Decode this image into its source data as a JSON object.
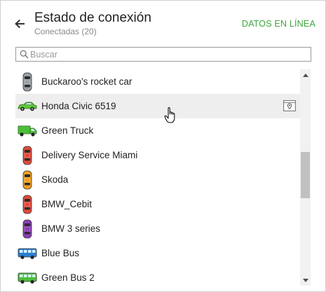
{
  "header": {
    "title": "Estado de conexión",
    "subtitle": "Conectadas (20)",
    "back_icon": "arrow-left-icon",
    "data_link": "DATOS EN LÍNEA"
  },
  "search": {
    "placeholder": "Buscar",
    "value": "",
    "icon": "search-icon"
  },
  "colors": {
    "accent": "#3aa63a",
    "hover_row": "#eeeeee",
    "scroll_thumb": "#c1c1c1"
  },
  "vehicles": [
    {
      "label": "Buckaroo's rocket car",
      "icon": "car-top-icon",
      "color": "#9aa0a6"
    },
    {
      "label": "Honda Civic 6519",
      "icon": "car-side-icon",
      "color": "#5cc93a",
      "hovered": true,
      "action_icon": "map-pin-icon"
    },
    {
      "label": "Green Truck",
      "icon": "truck-icon",
      "color": "#4cbf3a"
    },
    {
      "label": "Delivery Service Miami",
      "icon": "car-top-icon",
      "color": "#e14b3b"
    },
    {
      "label": "Skoda",
      "icon": "car-top-icon",
      "color": "#f0a020"
    },
    {
      "label": "BMW_Cebit",
      "icon": "car-top-icon",
      "color": "#e14b3b"
    },
    {
      "label": "BMW 3 series",
      "icon": "car-top-icon",
      "color": "#8a3fb5"
    },
    {
      "label": "Blue Bus",
      "icon": "bus-icon",
      "color": "#2a7fd4"
    },
    {
      "label": "Green Bus 2",
      "icon": "bus-icon",
      "color": "#4cbf3a"
    }
  ]
}
